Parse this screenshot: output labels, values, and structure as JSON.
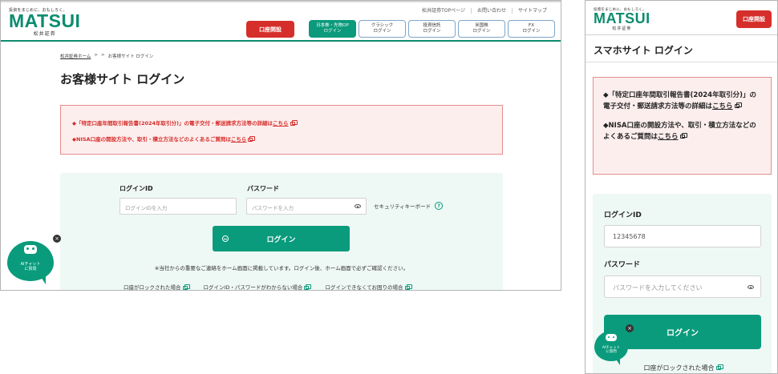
{
  "logo": {
    "tagline": "投資をまじめに、おもしろく。",
    "wordmark": "MATSUI",
    "sub": "松井証券"
  },
  "desktop": {
    "util_links": [
      "松井証券TOPページ",
      "お問い合わせ",
      "サイトマップ"
    ],
    "open_account": "口座開設",
    "tabs": [
      {
        "line1": "日本株・先物OP",
        "line2": "ログイン",
        "active": true
      },
      {
        "line1": "クラシック",
        "line2": "ログイン",
        "active": false
      },
      {
        "line1": "投資信託",
        "line2": "ログイン",
        "active": false
      },
      {
        "line1": "米国株",
        "line2": "ログイン",
        "active": false
      },
      {
        "line1": "FX",
        "line2": "ログイン",
        "active": false
      }
    ],
    "breadcrumb": {
      "home": "松井証券ホーム",
      "sep": ">",
      "current": "お客様サイト ログイン"
    },
    "title": "お客様サイト ログイン",
    "notices": [
      {
        "text": "◆「特定口座年間取引報告書(2024年取引分)」の電子交付・郵送請求方法等の詳細は",
        "link": "こちら"
      },
      {
        "text": "◆NISA口座の開設方法や、取引・積立方法などのよくあるご質問は",
        "link": "こちら"
      }
    ],
    "login_id_label": "ログインID",
    "login_id_placeholder": "ログインIDを入力",
    "password_label": "パスワード",
    "password_placeholder": "パスワードを入力",
    "security_keyboard": "セキュリティキーボード",
    "help_mark": "?",
    "login_button": "ログイン",
    "note": "※当社からの重要なご連絡をホーム画面に掲載しています。ログイン後、ホーム画面で必ずご確認ください。",
    "help_links": [
      "口座がロックされた場合",
      "ログインID・パスワードがわからない場合",
      "ログインできなくてお困りの場合"
    ]
  },
  "ai_chat": {
    "line1": "AIチャット",
    "line2": "に質問",
    "close": "×"
  },
  "mobile": {
    "open_account": "口座開設",
    "title": "スマホサイト ログイン",
    "notices": [
      {
        "text": "◆「特定口座年間取引報告書(2024年取引分)」の電子交付・郵送請求方法等の詳細は",
        "link": "こちら"
      },
      {
        "text": "◆NISA口座の開設方法や、取引・積立方法などのよくあるご質問は",
        "link": "こちら"
      }
    ],
    "login_id_label": "ログインID",
    "login_id_value": "12345678",
    "password_label": "パスワード",
    "password_placeholder": "パスワードを入力してください",
    "login_button": "ログイン",
    "help_link": "口座がロックされた場合"
  },
  "colors": {
    "brand_green": "#0a9b7c",
    "accent_red": "#d62e2a",
    "notice_bg": "#fdeeee"
  }
}
